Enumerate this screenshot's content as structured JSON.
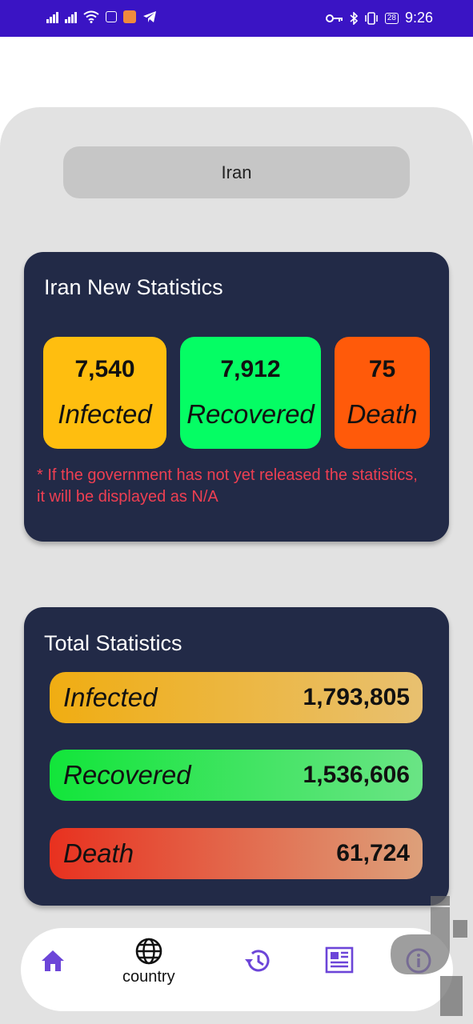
{
  "status_bar": {
    "time": "9:26",
    "battery": "28"
  },
  "country_select": {
    "value": "Iran"
  },
  "new_stats": {
    "title": "Iran New Statistics",
    "infected": {
      "value": "7,540",
      "label": "Infected"
    },
    "recovered": {
      "value": "7,912",
      "label": "Recovered"
    },
    "death": {
      "value": "75",
      "label": "Death"
    },
    "note": "* If the government has not yet released the statistics, it will be displayed as N/A"
  },
  "total_stats": {
    "title": "Total Statistics",
    "infected": {
      "label": "Infected",
      "value": "1,793,805"
    },
    "recovered": {
      "label": "Recovered",
      "value": "1,536,606"
    },
    "death": {
      "label": "Death",
      "value": "61,724"
    }
  },
  "bottom_nav": {
    "items": [
      {
        "icon": "home-icon",
        "label": ""
      },
      {
        "icon": "globe-icon",
        "label": "country"
      },
      {
        "icon": "history-icon",
        "label": ""
      },
      {
        "icon": "news-icon",
        "label": ""
      },
      {
        "icon": "info-icon",
        "label": ""
      }
    ]
  },
  "colors": {
    "status_bar": "#3a14c4",
    "card": "#222a47",
    "infected": "#ffbe0f",
    "recovered": "#05fd64",
    "death": "#ff5a0a",
    "note": "#ee3f52",
    "nav_icon": "#6c45d8"
  }
}
